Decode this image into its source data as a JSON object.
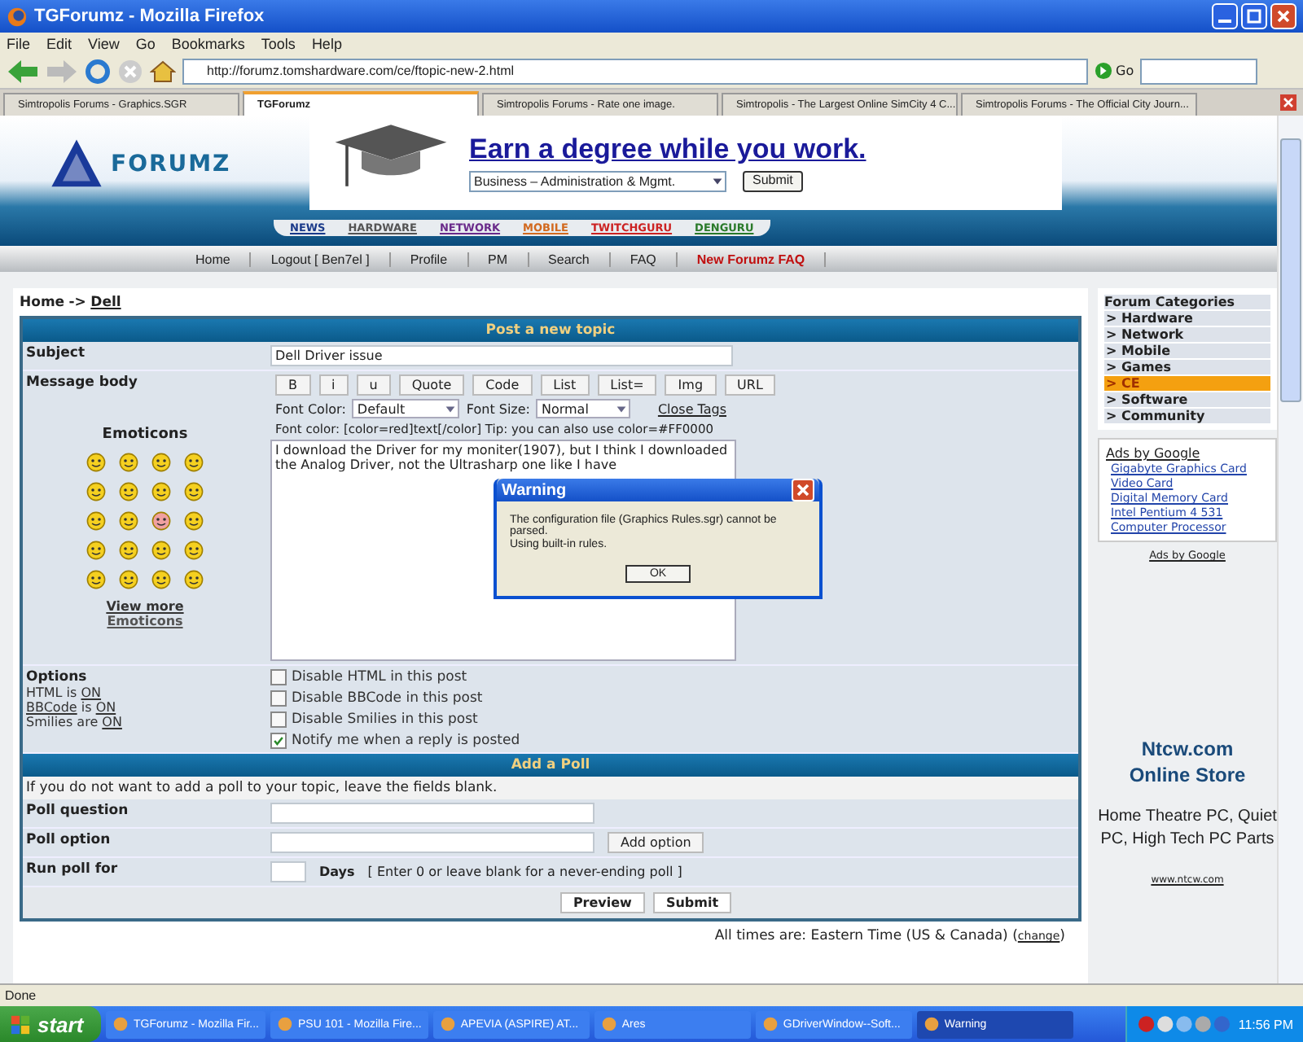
{
  "window": {
    "title": "TGForumz - Mozilla Firefox"
  },
  "menu": [
    "File",
    "Edit",
    "View",
    "Go",
    "Bookmarks",
    "Tools",
    "Help"
  ],
  "address": {
    "url": "http://forumz.tomshardware.com/ce/ftopic-new-2.html",
    "go": "Go"
  },
  "tabs": [
    {
      "label": "Simtropolis Forums - Graphics.SGR",
      "selected": false
    },
    {
      "label": "TGForumz",
      "selected": true
    },
    {
      "label": "Simtropolis Forums - Rate one image.",
      "selected": false
    },
    {
      "label": "Simtropolis - The Largest Online SimCity 4 C...",
      "selected": false
    },
    {
      "label": "Simtropolis Forums - The Official City Journ...",
      "selected": false
    }
  ],
  "site": {
    "logo": "FORUMZ",
    "ad_headline": "Earn a degree while you work.",
    "ad_select": "Business – Administration & Mgmt.",
    "ad_button": "Submit",
    "sections": [
      {
        "label": "NEWS",
        "color": "#1a3a8a"
      },
      {
        "label": "HARDWARE",
        "color": "#555555"
      },
      {
        "label": "NETWORK",
        "color": "#6a2a8a"
      },
      {
        "label": "MOBILE",
        "color": "#d2691e"
      },
      {
        "label": "TWITCHGURU",
        "color": "#cc2222"
      },
      {
        "label": "DENGURU",
        "color": "#2a7a2a"
      }
    ],
    "nav": [
      {
        "label": "Home",
        "kind": "normal"
      },
      {
        "label": "Logout [ Ben7el ]",
        "kind": "normal"
      },
      {
        "label": "Profile",
        "kind": "normal"
      },
      {
        "label": "PM",
        "kind": "normal"
      },
      {
        "label": "Search",
        "kind": "normal"
      },
      {
        "label": "FAQ",
        "kind": "normal"
      },
      {
        "label": "New Forumz FAQ",
        "kind": "highlight"
      }
    ]
  },
  "breadcrumb": {
    "home": "Home",
    "separator": "->",
    "current": "Dell"
  },
  "post": {
    "title": "Post a new topic",
    "subject_label": "Subject",
    "subject": "Dell Driver issue",
    "body_label": "Message body",
    "format_buttons": [
      "B",
      "i",
      "u",
      "Quote",
      "Code",
      "List",
      "List=",
      "Img",
      "URL"
    ],
    "font_color_label": "Font Color:",
    "font_color": "Default",
    "font_size_label": "Font Size:",
    "font_size": "Normal",
    "close_tags": "Close Tags",
    "tip": "Font color: [color=red]text[/color]  Tip: you can also use color=#FF0000",
    "body": "I download the Driver for my moniter(1907), but I think I downloaded the Analog Driver, not the Ultrasharp one like I have",
    "emoticons_title": "Emoticons",
    "view_more": "View more",
    "view_more_2": "Emoticons"
  },
  "options": {
    "title": "Options",
    "status": [
      {
        "name": "HTML",
        "name_link": false,
        "verb": "is",
        "value": "ON"
      },
      {
        "name": "BBCode",
        "name_link": true,
        "verb": "is",
        "value": "ON"
      },
      {
        "name": "Smilies",
        "name_link": false,
        "verb": "are",
        "value": "ON"
      }
    ],
    "checkboxes": [
      {
        "label": "Disable HTML in this post",
        "checked": false
      },
      {
        "label": "Disable BBCode in this post",
        "checked": false
      },
      {
        "label": "Disable Smilies in this post",
        "checked": false
      },
      {
        "label": "Notify me when a reply is posted",
        "checked": true
      }
    ]
  },
  "poll": {
    "title": "Add a Poll",
    "hint": "If you do not want to add a poll to your topic, leave the fields blank.",
    "fields": [
      {
        "label": "Poll question",
        "kind": "text"
      },
      {
        "label": "Poll option",
        "kind": "option",
        "button": "Add option"
      },
      {
        "label": "Run poll for",
        "kind": "days",
        "unit": "Days",
        "note": "[ Enter 0 or leave blank for a never-ending poll ]"
      }
    ],
    "buttons": [
      "Preview",
      "Submit"
    ]
  },
  "footer": {
    "text": "All times are: Eastern Time (US & Canada) (",
    "link": "change",
    "close": ")"
  },
  "sidebar": {
    "categories_title": "Forum Categories",
    "categories": [
      {
        "label": "> Hardware",
        "selected": false
      },
      {
        "label": "> Network",
        "selected": false
      },
      {
        "label": "> Mobile",
        "selected": false
      },
      {
        "label": "> Games",
        "selected": false
      },
      {
        "label": "> CE",
        "selected": true
      },
      {
        "label": "> Software",
        "selected": false
      },
      {
        "label": "> Community",
        "selected": false
      }
    ],
    "ads_title": "Ads by Google",
    "ads": [
      "Gigabyte Graphics Card",
      "Video Card",
      "Digital Memory Card",
      "Intel Pentium 4 531",
      "Computer Processor"
    ],
    "ads_footer": "Ads by Google",
    "store_title": "Ntcw.com",
    "store_title_2": "Online Store",
    "store_text": "Home Theatre PC, Quiet PC, High Tech PC Parts",
    "store_url": "www.ntcw.com"
  },
  "dialog": {
    "title": "Warning",
    "lines": [
      "The configuration file (Graphics Rules.sgr) cannot be parsed.",
      "Using built-in rules."
    ],
    "ok": "OK"
  },
  "status_bar": "Done",
  "taskbar": {
    "start": "start",
    "items": [
      {
        "label": "TGForumz - Mozilla Fir...",
        "selected": false
      },
      {
        "label": "PSU 101 - Mozilla Fire...",
        "selected": false
      },
      {
        "label": "APEVIA (ASPIRE) AT...",
        "selected": false
      },
      {
        "label": "Ares",
        "selected": false
      },
      {
        "label": "GDriverWindow--Soft...",
        "selected": false
      },
      {
        "label": "Warning",
        "selected": true
      }
    ],
    "clock": "11:56 PM"
  }
}
